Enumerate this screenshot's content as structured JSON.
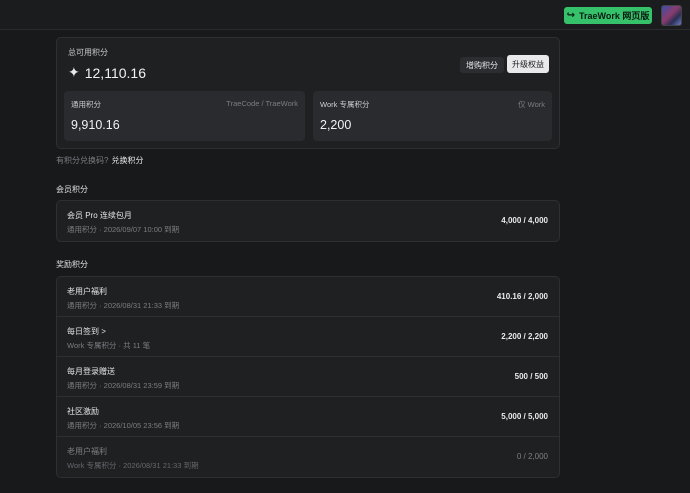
{
  "topbar": {
    "web_button_label": "TraeWork 网页版",
    "web_button_icon": "login-arrow-icon"
  },
  "summary": {
    "label": "总可用积分",
    "icon": "sparkle-icon",
    "value": "12,110.16",
    "buy_label": "增购积分",
    "upgrade_label": "升级权益",
    "general": {
      "label": "通用积分",
      "tag": "TraeCode / TraeWork",
      "value": "9,910.16"
    },
    "work": {
      "label": "Work 专属积分",
      "tag": "仅 Work",
      "value": "2,200"
    }
  },
  "redeem": {
    "prompt": "有积分兑换码?",
    "link": "兑换积分"
  },
  "membership": {
    "title": "会员积分",
    "items": [
      {
        "name": "会员 Pro 连续包月",
        "meta": "通用积分 · 2026/09/07 10:00 到期",
        "amount": "4,000 / 4,000"
      }
    ]
  },
  "rewards": {
    "title": "奖励积分",
    "items": [
      {
        "name": "老用户福利",
        "meta": "通用积分 · 2026/08/31 21:33 到期",
        "amount": "410.16 / 2,000"
      },
      {
        "name": "每日签到 >",
        "meta": "Work 专属积分 · 共 11 笔",
        "amount": "2,200 / 2,200"
      },
      {
        "name": "每月登录赠送",
        "meta": "通用积分 · 2026/08/31 23:59 到期",
        "amount": "500 / 500"
      },
      {
        "name": "社区激励",
        "meta": "通用积分 · 2026/10/05 23:56 到期",
        "amount": "5,000 / 5,000"
      },
      {
        "name": "老用户福利",
        "meta": "Work 专属积分 · 2026/08/31 21:33 到期",
        "amount": "0 / 2,000"
      }
    ]
  }
}
